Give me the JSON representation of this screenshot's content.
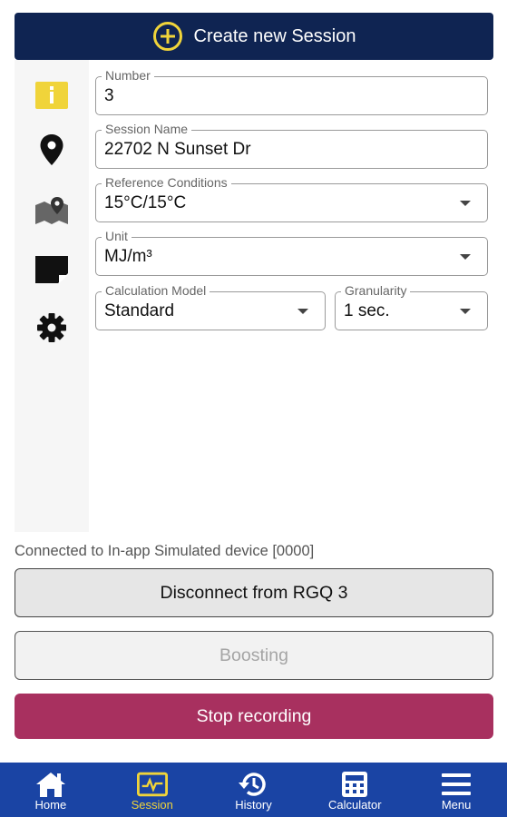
{
  "header": {
    "create_label": "Create new Session"
  },
  "form": {
    "number": {
      "label": "Number",
      "value": "3"
    },
    "session_name": {
      "label": "Session Name",
      "value": "22702 N Sunset Dr"
    },
    "reference_conditions": {
      "label": "Reference Conditions",
      "value": "15°C/15°C"
    },
    "unit": {
      "label": "Unit",
      "value": "MJ/m³"
    },
    "calculation_model": {
      "label": "Calculation Model",
      "value": "Standard"
    },
    "granularity": {
      "label": "Granularity",
      "value": "1 sec."
    }
  },
  "sidebar_icons": [
    "info-icon",
    "location-pin-icon",
    "map-icon",
    "note-icon",
    "gear-icon"
  ],
  "status": {
    "connection_text": "Connected to In-app Simulated device [0000]"
  },
  "buttons": {
    "disconnect": "Disconnect from RGQ 3",
    "boosting": "Boosting",
    "stop_recording": "Stop recording"
  },
  "nav": {
    "items": [
      {
        "label": "Home",
        "icon": "home-icon",
        "active": false
      },
      {
        "label": "Session",
        "icon": "session-icon",
        "active": true
      },
      {
        "label": "History",
        "icon": "history-icon",
        "active": false
      },
      {
        "label": "Calculator",
        "icon": "calculator-icon",
        "active": false
      },
      {
        "label": "Menu",
        "icon": "menu-icon",
        "active": false
      }
    ]
  },
  "colors": {
    "header_bg": "#0f2452",
    "accent_yellow": "#f0d43a",
    "stop_button": "#a8305f",
    "nav_bg": "#1a44a4"
  }
}
